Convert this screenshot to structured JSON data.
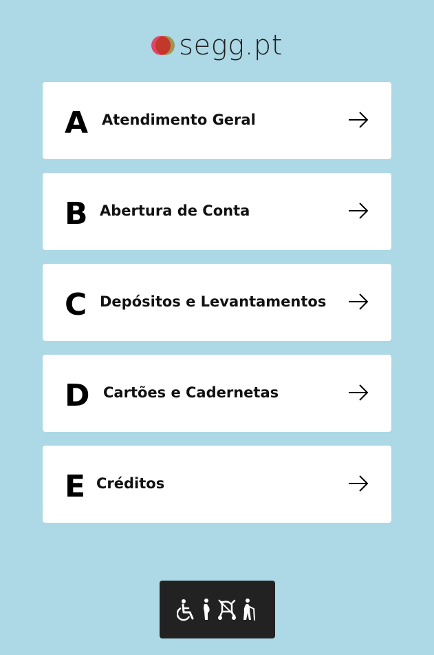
{
  "brand": {
    "logo_text": "segg.pt",
    "colors": {
      "primary": "#e2446a",
      "secondary": "#e8a23c"
    }
  },
  "background_color": "#add8e6",
  "services": [
    {
      "letter": "A",
      "label": "Atendimento Geral",
      "icon": "arrow-right-icon"
    },
    {
      "letter": "B",
      "label": "Abertura de Conta",
      "icon": "arrow-right-icon"
    },
    {
      "letter": "C",
      "label": "Depósitos e Levantamentos",
      "icon": "arrow-right-icon"
    },
    {
      "letter": "D",
      "label": "Cartões e Cadernetas",
      "icon": "arrow-right-icon"
    },
    {
      "letter": "E",
      "label": "Créditos",
      "icon": "arrow-right-icon"
    }
  ],
  "priority_button": {
    "icons": [
      "wheelchair-icon",
      "pregnant-person-icon",
      "baby-stroller-icon",
      "elderly-person-icon"
    ],
    "background_color": "#222222"
  }
}
